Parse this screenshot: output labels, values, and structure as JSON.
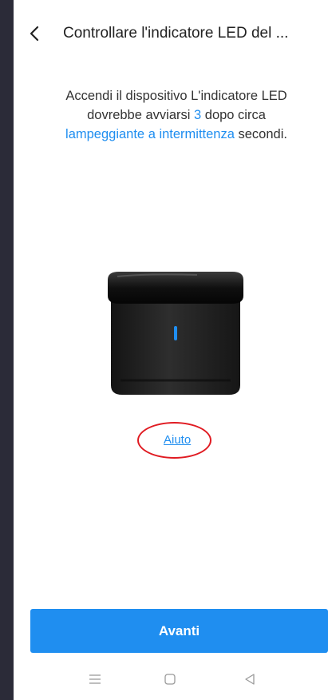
{
  "header": {
    "title": "Controllare l'indicatore LED del ...",
    "back_icon": "chevron-left-icon"
  },
  "instruction": {
    "part1": "Accendi il dispositivo L'indicatore LED dovrebbe avviarsi ",
    "seconds_value": "3",
    "part2": " dopo circa ",
    "blink_mode": "lampeggiante a intermittenza",
    "part3": " secondi."
  },
  "device": {
    "image": "ir-blaster-device",
    "led_color": "#1f8ef0"
  },
  "help": {
    "label": "Aiuto",
    "highlight_color": "#e01b22"
  },
  "footer": {
    "next_label": "Avanti",
    "button_color": "#1f8ef0"
  },
  "system_nav": {
    "items": [
      "menu-icon",
      "home-icon",
      "back-triangle-icon"
    ]
  }
}
